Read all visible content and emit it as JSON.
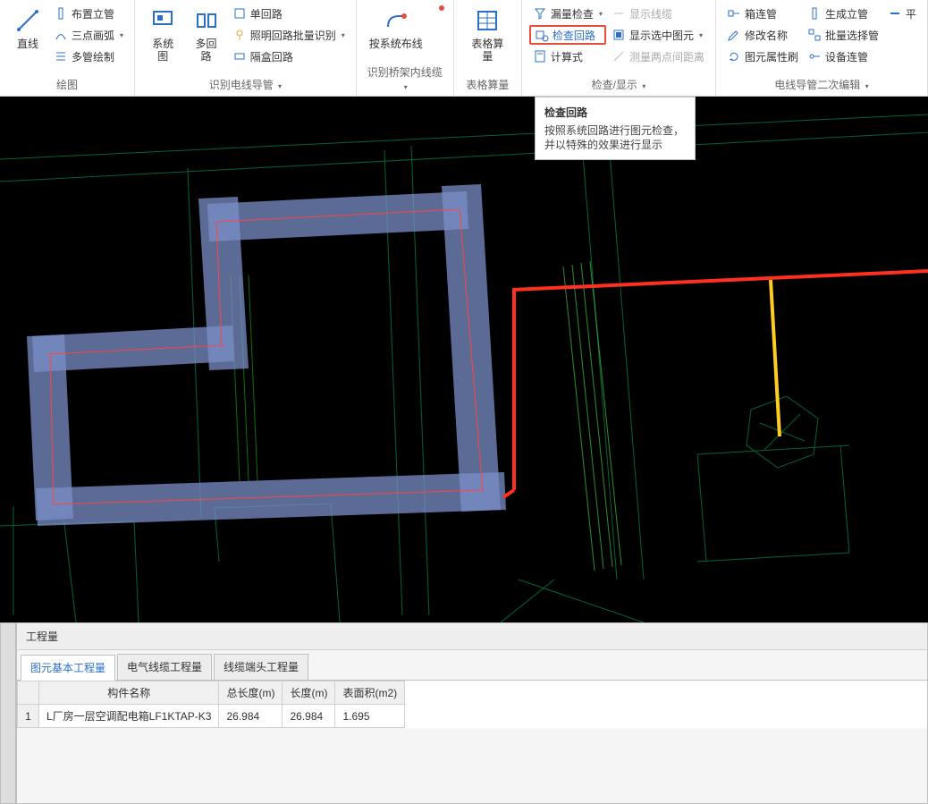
{
  "ribbon": {
    "groups": [
      {
        "name": "绘图",
        "big": [
          {
            "icon": "line-icon",
            "label": "直线"
          }
        ],
        "cols": [
          [
            {
              "icon": "pipe-icon",
              "label": "布置立管"
            },
            {
              "icon": "arc-icon",
              "label": "三点画弧",
              "caret": true
            },
            {
              "icon": "multipipe-icon",
              "label": "多管绘制"
            }
          ]
        ]
      },
      {
        "name": "识别电线导管",
        "caret": true,
        "big": [
          {
            "icon": "sysdiagram-icon",
            "label": "系统图"
          },
          {
            "icon": "multiloop-icon",
            "label": "多回路"
          }
        ],
        "cols": [
          [
            {
              "icon": "singleloop-icon",
              "label": "单回路"
            },
            {
              "icon": "lightloop-icon",
              "label": "照明回路批量识别",
              "caret": true
            },
            {
              "icon": "hiddenloop-icon",
              "label": "隔盒回路"
            }
          ]
        ]
      },
      {
        "name": "识别桥架内线缆",
        "caret": true,
        "big": [
          {
            "icon": "route-icon",
            "label": "按系统布线"
          }
        ],
        "dot": true
      },
      {
        "name": "表格算量",
        "big": [
          {
            "icon": "grid-icon",
            "label": "表格算量"
          }
        ]
      },
      {
        "name": "检查/显示",
        "caret": true,
        "cols": [
          [
            {
              "icon": "funnel-icon",
              "label": "漏量检查",
              "caret": true
            },
            {
              "icon": "checkloop-icon",
              "label": "检查回路",
              "highlight": true
            },
            {
              "icon": "calc-icon",
              "label": "计算式"
            }
          ],
          [
            {
              "icon": "showline-icon",
              "label": "显示线缆",
              "disabled": true
            },
            {
              "icon": "showsel-icon",
              "label": "显示选中图元",
              "caret": true
            },
            {
              "icon": "measure-icon",
              "label": "测量两点间距离",
              "disabled": true
            }
          ]
        ]
      },
      {
        "name": "电线导管二次编辑",
        "caret": true,
        "cols": [
          [
            {
              "icon": "connect-icon",
              "label": "箱连管"
            },
            {
              "icon": "rename-icon",
              "label": "修改名称"
            },
            {
              "icon": "refresh-icon",
              "label": "图元属性刷"
            }
          ],
          [
            {
              "icon": "genpipe-icon",
              "label": "生成立管"
            },
            {
              "icon": "batchsel-icon",
              "label": "批量选择管"
            },
            {
              "icon": "devconn-icon",
              "label": "设备连管"
            }
          ],
          [
            {
              "icon": "flat-icon",
              "label": "平"
            }
          ]
        ]
      }
    ]
  },
  "tooltip": {
    "title": "检查回路",
    "body": "按照系统回路进行图元检查，并以特殊的效果进行显示"
  },
  "panel": {
    "title": "工程量",
    "tabs": [
      "图元基本工程量",
      "电气线缆工程量",
      "线缆端头工程量"
    ],
    "active_tab": 0,
    "columns": [
      "",
      "构件名称",
      "总长度(m)",
      "长度(m)",
      "表面积(m2)"
    ],
    "rows": [
      {
        "num": "1",
        "name": "L厂房一层空调配电箱LF1KTAP-K3",
        "total": "26.984",
        "len": "26.984",
        "area": "1.695"
      }
    ]
  }
}
